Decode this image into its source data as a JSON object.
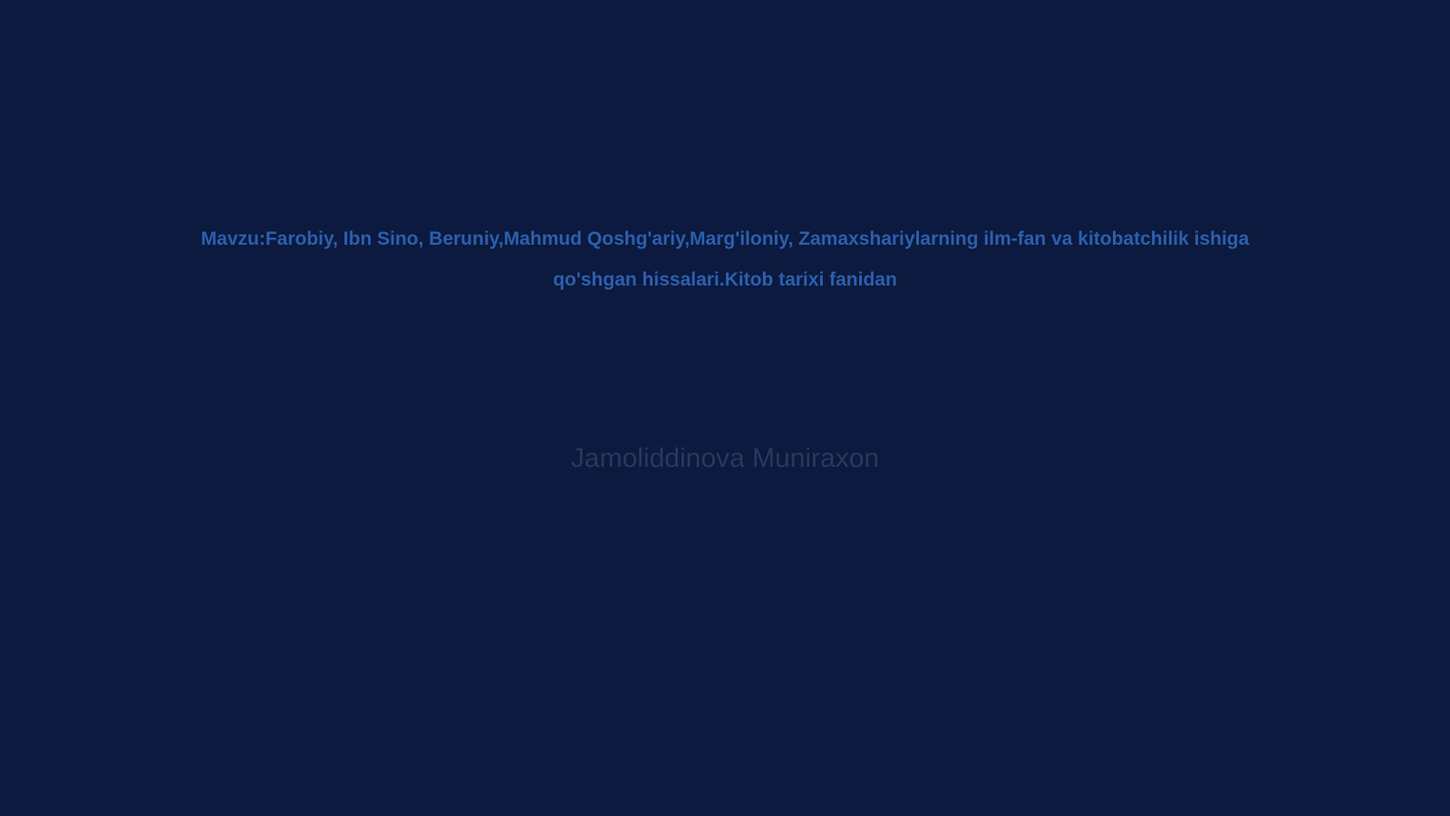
{
  "slide": {
    "title": "Mavzu:Farobiy, Ibn Sino, Beruniy,Mahmud Qoshg'ariy,Marg'iloniy, Zamaxshariylarning ilm-fan va kitobatchilik ishiga qo'shgan hissalari.Kitob tarixi fanidan",
    "subtitle": "Jamoliddinova Muniraxon"
  },
  "colors": {
    "background": "#0b1a3e",
    "title": "#2d5fae",
    "subtitle": "#27395d"
  }
}
